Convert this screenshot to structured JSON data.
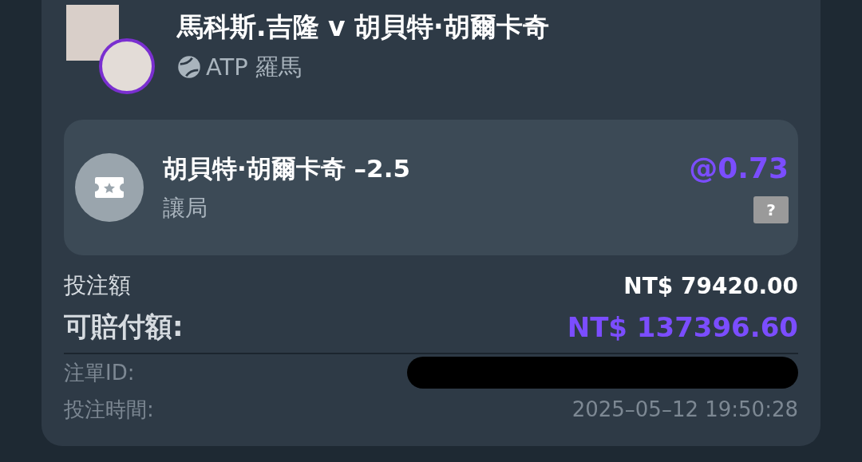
{
  "match": {
    "title": "馬科斯.吉隆 v 胡貝特·胡爾卡奇",
    "tournament": "ATP 羅馬"
  },
  "selection": {
    "name": "胡貝特·胡爾卡奇 –2.5",
    "market": "讓局",
    "odds": "@0.73",
    "help": "?"
  },
  "amounts": [
    {
      "kind": "stake",
      "label": "投注額",
      "value": "NT$ 79420.00"
    },
    {
      "kind": "payout",
      "label": "可賠付額:",
      "value": "NT$ 137396.60"
    }
  ],
  "details": [
    {
      "kind": "redacted",
      "label": "注單ID:"
    },
    {
      "kind": "text",
      "label": "投注時間:",
      "value": "2025–05–12 19:50:28"
    }
  ]
}
